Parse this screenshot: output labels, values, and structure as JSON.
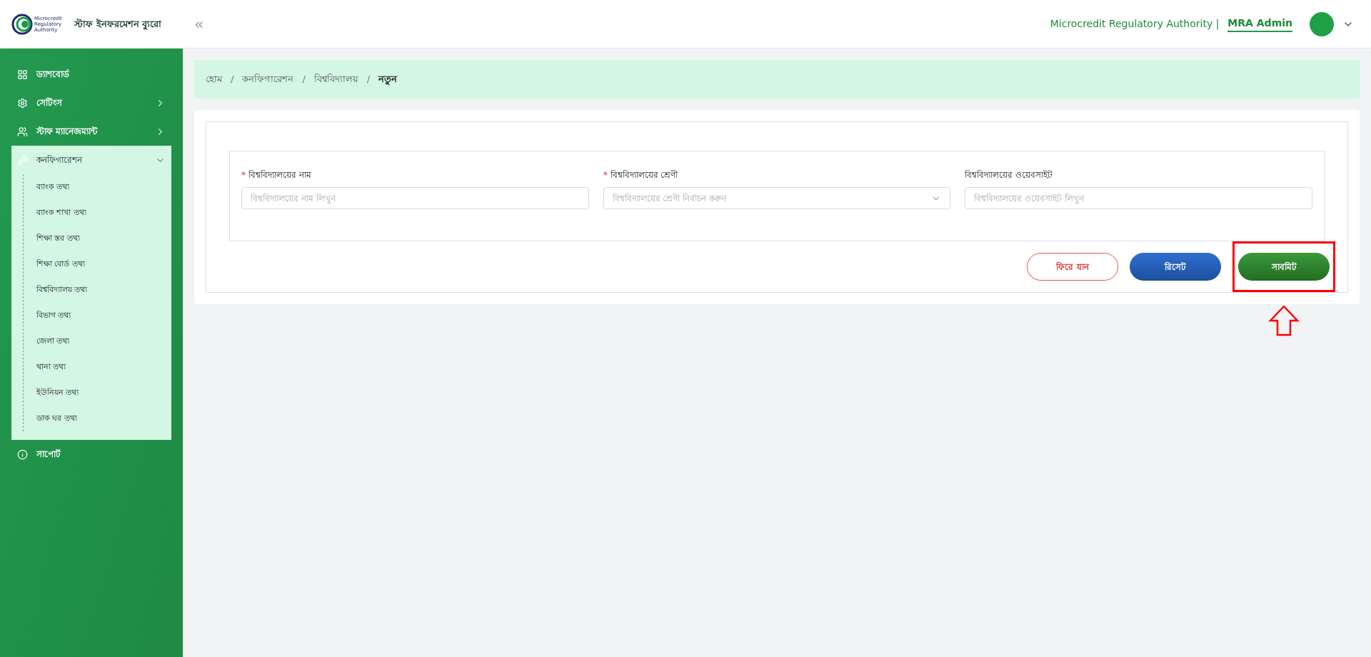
{
  "header": {
    "logo_text": "Microcredit Regulatory Authority",
    "app_title": "স্টাফ ইনফরমেশন ব্যুরো",
    "collapse_icon": "«",
    "organization": "Microcredit Regulatory Authority |",
    "user": "MRA Admin"
  },
  "sidebar": {
    "items": [
      {
        "kind": "dashboard",
        "label": "ড্যাশবোর্ড",
        "expanded": false
      },
      {
        "kind": "settings",
        "label": "সেটিংস",
        "expanded": false
      },
      {
        "kind": "staff",
        "label": "স্টাফ ম্যানেজম্যান্ট",
        "expanded": false
      },
      {
        "kind": "config",
        "label": "কনফিগারেশন",
        "expanded": true,
        "children": [
          {
            "label": "ব্যাংক তথ্য",
            "selected": false
          },
          {
            "label": "ব্যাংক শাখা তথ্য",
            "selected": false
          },
          {
            "label": "শিক্ষা স্তর তথ্য",
            "selected": false
          },
          {
            "label": "শিক্ষা বোর্ড তথ্য",
            "selected": false
          },
          {
            "label": "বিশ্ববিদ্যালয় তথ্য",
            "selected": false
          },
          {
            "label": "বিভাগ তথ্য",
            "selected": false
          },
          {
            "label": "জেলা তথ্য",
            "selected": false
          },
          {
            "label": "থানা তথ্য",
            "selected": false
          },
          {
            "label": "ইউনিয়ন তথ্য",
            "selected": false
          },
          {
            "label": "ডাক ঘর তথ্য",
            "selected": false
          }
        ]
      },
      {
        "kind": "support",
        "label": "সাপোর্ট",
        "expanded": false
      }
    ]
  },
  "breadcrumb": [
    "হোম",
    "/",
    "কনফিগারেশন",
    "/",
    "বিশ্ববিদ্যালয়",
    "/",
    "নতুন"
  ],
  "form": {
    "required_mark": "*",
    "fields": [
      {
        "kind": "text",
        "label": "বিশ্ববিদ্যালয়ের নাম",
        "required": true,
        "placeholder": "বিশ্ববিদ্যালয়ের নাম লিখুন"
      },
      {
        "kind": "select",
        "label": "বিশ্ববিদ্যালয়ের শ্রেণী",
        "required": true,
        "placeholder": "বিশ্ববিদ্যালয়ের শ্রেণী নির্বাচন করুন"
      },
      {
        "kind": "text",
        "label": "বিশ্ববিদ্যালয়ের ওয়েবসাইট",
        "required": false,
        "placeholder": "বিশ্ববিদ্যালয়ের ওয়েবসাইট লিখুন"
      }
    ],
    "buttons": [
      {
        "kind": "back",
        "label": "ফিরে যান",
        "highlighted": false
      },
      {
        "kind": "reset",
        "label": "রিসেট",
        "highlighted": false
      },
      {
        "kind": "submit",
        "label": "সাবমিট",
        "highlighted": true
      }
    ]
  }
}
